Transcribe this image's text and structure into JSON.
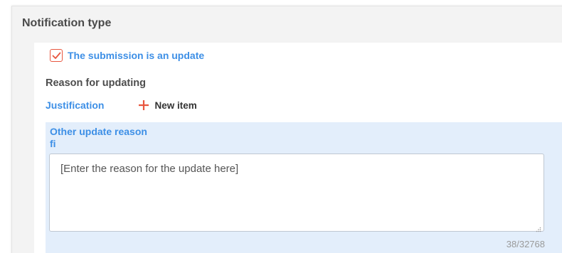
{
  "section": {
    "title": "Notification type"
  },
  "update_checkbox": {
    "label": "The submission is an update",
    "checked": true,
    "check_color": "#e8563f"
  },
  "reason_section": {
    "heading": "Reason for updating",
    "justification_label": "Justification",
    "new_item_label": "New item",
    "plus_icon": "plus-icon",
    "plus_color": "#e8563f"
  },
  "other_update_reason": {
    "title": "Other update reason",
    "language_code": "fi",
    "text": "[Enter the reason for the update here]",
    "counter": "38/32768"
  },
  "colors": {
    "link_blue": "#3d8fe6",
    "block_background": "#e3eefb",
    "panel_background": "#f3f3f3"
  }
}
